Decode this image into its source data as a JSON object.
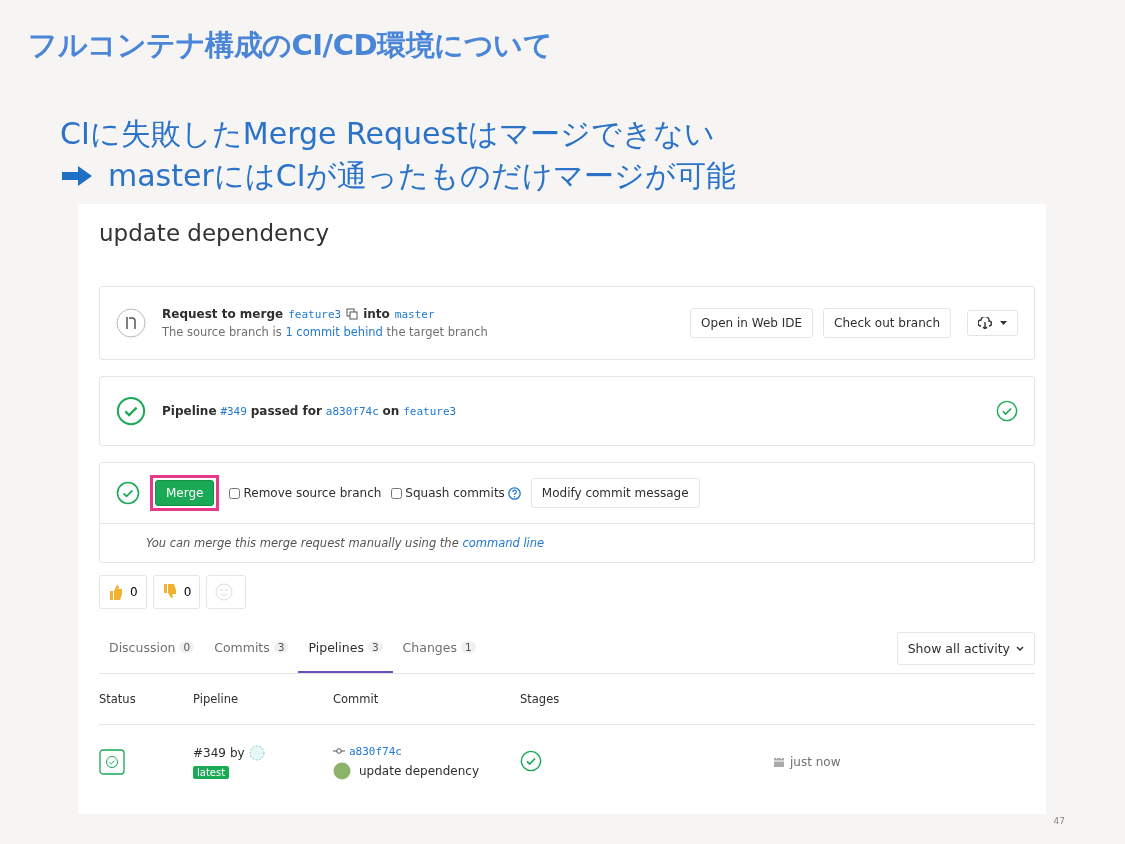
{
  "slide": {
    "title": "フルコンテナ構成のCI/CD環境について",
    "bullets": [
      {
        "kind": "plain",
        "text": "CIに失敗したMerge Requestはマージできない"
      },
      {
        "kind": "arrow",
        "text": "masterにはCIが通ったものだけマージが可能"
      }
    ],
    "page_number": "47"
  },
  "merge_request": {
    "title": "update dependency",
    "request": {
      "label": "Request to merge",
      "source_branch": "feature3",
      "into": "into",
      "target_branch": "master",
      "status_before": "The source branch is",
      "status_link": "1 commit behind",
      "status_after": "the target branch",
      "buttons": [
        "Open in Web IDE",
        "Check out branch"
      ]
    },
    "pipeline": {
      "label": "Pipeline",
      "id": "#349",
      "passed_for": "passed for",
      "commit": "a830f74c",
      "on": "on",
      "branch": "feature3"
    },
    "merge": {
      "button": "Merge",
      "highlighted": true,
      "options": [
        {
          "label": "Remove source branch",
          "checked": false
        },
        {
          "label": "Squash commits",
          "checked": false,
          "help": true
        }
      ],
      "modify_button": "Modify commit message",
      "note": "You can merge this merge request manually using the",
      "note_link": "command line"
    },
    "reactions": [
      {
        "kind": "thumbs_up",
        "count": "0"
      },
      {
        "kind": "thumbs_down",
        "count": "0"
      },
      {
        "kind": "add_emoji"
      }
    ],
    "tabs": [
      {
        "label": "Discussion",
        "count": "0",
        "selected": false
      },
      {
        "label": "Commits",
        "count": "3",
        "selected": false
      },
      {
        "label": "Pipelines",
        "count": "3",
        "selected": true
      },
      {
        "label": "Changes",
        "count": "1",
        "selected": false
      }
    ],
    "activity_dropdown": "Show all activity",
    "table": {
      "columns": [
        "Status",
        "Pipeline",
        "Commit",
        "Stages"
      ],
      "rows": [
        {
          "pipeline_id": "#349",
          "by": "by",
          "badge": "latest",
          "commit": "a830f74c",
          "commit_title": "update dependency",
          "time": "just now"
        }
      ]
    }
  }
}
